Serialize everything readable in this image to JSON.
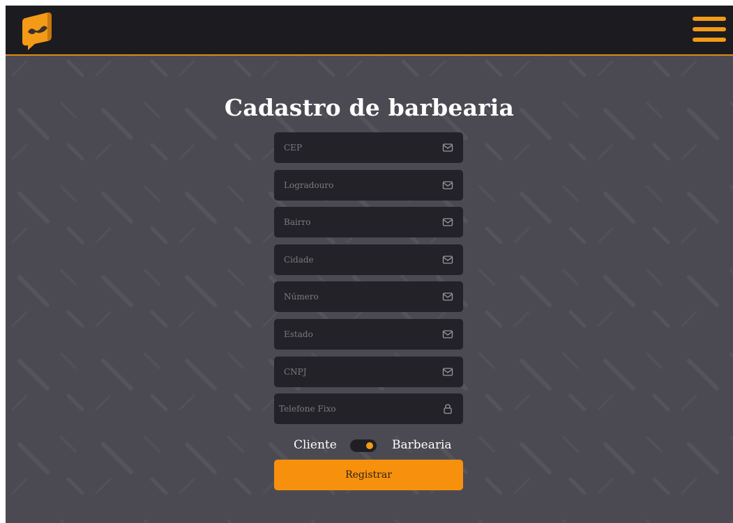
{
  "header": {
    "logo_icon": "mustache-speech-bubble-icon",
    "menu_icon": "hamburger-menu-icon"
  },
  "form": {
    "title": "Cadastro de barbearia",
    "fields": [
      {
        "placeholder": "CEP",
        "value": "",
        "icon": "mail-icon"
      },
      {
        "placeholder": "Logradouro",
        "value": "",
        "icon": "mail-icon"
      },
      {
        "placeholder": "Bairro",
        "value": "",
        "icon": "mail-icon"
      },
      {
        "placeholder": "Cidade",
        "value": "",
        "icon": "mail-icon"
      },
      {
        "placeholder": "Número",
        "value": "",
        "icon": "mail-icon"
      },
      {
        "placeholder": "Estado",
        "value": "",
        "icon": "mail-icon"
      },
      {
        "placeholder": "CNPJ",
        "value": "",
        "icon": "mail-icon"
      },
      {
        "placeholder": "Telefone Fixo",
        "value": "",
        "icon": "lock-icon"
      }
    ],
    "toggle": {
      "left_label": "Cliente",
      "right_label": "Barbearia",
      "selected": "Barbearia"
    },
    "submit_label": "Registrar"
  },
  "colors": {
    "accent": "#f7900c",
    "header_bg": "#1c1b20",
    "page_bg": "#4b4a52",
    "field_bg": "#232228"
  }
}
